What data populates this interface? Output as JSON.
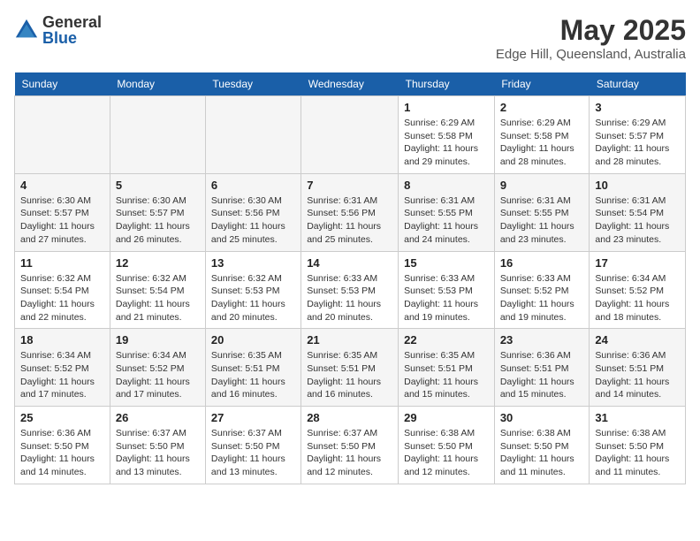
{
  "logo": {
    "general": "General",
    "blue": "Blue"
  },
  "title": "May 2025",
  "location": "Edge Hill, Queensland, Australia",
  "days_of_week": [
    "Sunday",
    "Monday",
    "Tuesday",
    "Wednesday",
    "Thursday",
    "Friday",
    "Saturday"
  ],
  "weeks": [
    [
      {
        "day": "",
        "info": ""
      },
      {
        "day": "",
        "info": ""
      },
      {
        "day": "",
        "info": ""
      },
      {
        "day": "",
        "info": ""
      },
      {
        "day": "1",
        "info": "Sunrise: 6:29 AM\nSunset: 5:58 PM\nDaylight: 11 hours and 29 minutes."
      },
      {
        "day": "2",
        "info": "Sunrise: 6:29 AM\nSunset: 5:58 PM\nDaylight: 11 hours and 28 minutes."
      },
      {
        "day": "3",
        "info": "Sunrise: 6:29 AM\nSunset: 5:57 PM\nDaylight: 11 hours and 28 minutes."
      }
    ],
    [
      {
        "day": "4",
        "info": "Sunrise: 6:30 AM\nSunset: 5:57 PM\nDaylight: 11 hours and 27 minutes."
      },
      {
        "day": "5",
        "info": "Sunrise: 6:30 AM\nSunset: 5:57 PM\nDaylight: 11 hours and 26 minutes."
      },
      {
        "day": "6",
        "info": "Sunrise: 6:30 AM\nSunset: 5:56 PM\nDaylight: 11 hours and 25 minutes."
      },
      {
        "day": "7",
        "info": "Sunrise: 6:31 AM\nSunset: 5:56 PM\nDaylight: 11 hours and 25 minutes."
      },
      {
        "day": "8",
        "info": "Sunrise: 6:31 AM\nSunset: 5:55 PM\nDaylight: 11 hours and 24 minutes."
      },
      {
        "day": "9",
        "info": "Sunrise: 6:31 AM\nSunset: 5:55 PM\nDaylight: 11 hours and 23 minutes."
      },
      {
        "day": "10",
        "info": "Sunrise: 6:31 AM\nSunset: 5:54 PM\nDaylight: 11 hours and 23 minutes."
      }
    ],
    [
      {
        "day": "11",
        "info": "Sunrise: 6:32 AM\nSunset: 5:54 PM\nDaylight: 11 hours and 22 minutes."
      },
      {
        "day": "12",
        "info": "Sunrise: 6:32 AM\nSunset: 5:54 PM\nDaylight: 11 hours and 21 minutes."
      },
      {
        "day": "13",
        "info": "Sunrise: 6:32 AM\nSunset: 5:53 PM\nDaylight: 11 hours and 20 minutes."
      },
      {
        "day": "14",
        "info": "Sunrise: 6:33 AM\nSunset: 5:53 PM\nDaylight: 11 hours and 20 minutes."
      },
      {
        "day": "15",
        "info": "Sunrise: 6:33 AM\nSunset: 5:53 PM\nDaylight: 11 hours and 19 minutes."
      },
      {
        "day": "16",
        "info": "Sunrise: 6:33 AM\nSunset: 5:52 PM\nDaylight: 11 hours and 19 minutes."
      },
      {
        "day": "17",
        "info": "Sunrise: 6:34 AM\nSunset: 5:52 PM\nDaylight: 11 hours and 18 minutes."
      }
    ],
    [
      {
        "day": "18",
        "info": "Sunrise: 6:34 AM\nSunset: 5:52 PM\nDaylight: 11 hours and 17 minutes."
      },
      {
        "day": "19",
        "info": "Sunrise: 6:34 AM\nSunset: 5:52 PM\nDaylight: 11 hours and 17 minutes."
      },
      {
        "day": "20",
        "info": "Sunrise: 6:35 AM\nSunset: 5:51 PM\nDaylight: 11 hours and 16 minutes."
      },
      {
        "day": "21",
        "info": "Sunrise: 6:35 AM\nSunset: 5:51 PM\nDaylight: 11 hours and 16 minutes."
      },
      {
        "day": "22",
        "info": "Sunrise: 6:35 AM\nSunset: 5:51 PM\nDaylight: 11 hours and 15 minutes."
      },
      {
        "day": "23",
        "info": "Sunrise: 6:36 AM\nSunset: 5:51 PM\nDaylight: 11 hours and 15 minutes."
      },
      {
        "day": "24",
        "info": "Sunrise: 6:36 AM\nSunset: 5:51 PM\nDaylight: 11 hours and 14 minutes."
      }
    ],
    [
      {
        "day": "25",
        "info": "Sunrise: 6:36 AM\nSunset: 5:50 PM\nDaylight: 11 hours and 14 minutes."
      },
      {
        "day": "26",
        "info": "Sunrise: 6:37 AM\nSunset: 5:50 PM\nDaylight: 11 hours and 13 minutes."
      },
      {
        "day": "27",
        "info": "Sunrise: 6:37 AM\nSunset: 5:50 PM\nDaylight: 11 hours and 13 minutes."
      },
      {
        "day": "28",
        "info": "Sunrise: 6:37 AM\nSunset: 5:50 PM\nDaylight: 11 hours and 12 minutes."
      },
      {
        "day": "29",
        "info": "Sunrise: 6:38 AM\nSunset: 5:50 PM\nDaylight: 11 hours and 12 minutes."
      },
      {
        "day": "30",
        "info": "Sunrise: 6:38 AM\nSunset: 5:50 PM\nDaylight: 11 hours and 11 minutes."
      },
      {
        "day": "31",
        "info": "Sunrise: 6:38 AM\nSunset: 5:50 PM\nDaylight: 11 hours and 11 minutes."
      }
    ]
  ]
}
